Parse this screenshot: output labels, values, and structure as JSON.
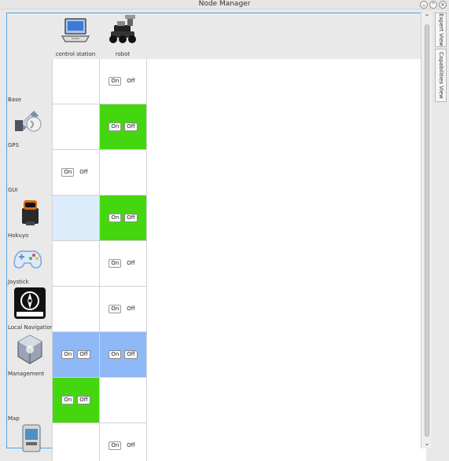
{
  "window": {
    "title": "Node Manager",
    "buttons": {
      "minimize": "⌄",
      "maximize": "⌃",
      "close": "×"
    }
  },
  "hosts": [
    {
      "label": "control station",
      "icon": "laptop-icon"
    },
    {
      "label": "robot",
      "icon": "robot-icon"
    }
  ],
  "rows": [
    {
      "label": "Base",
      "icon": null
    },
    {
      "label": "GPS",
      "icon": "gps-satellite-icon"
    },
    {
      "label": "GUI",
      "icon": null
    },
    {
      "label": "Hokuyo",
      "icon": "hokuyo-laser-icon"
    },
    {
      "label": "Joystick",
      "icon": "joystick-icon"
    },
    {
      "label": "Local Navigation",
      "icon": "navigation-icon"
    },
    {
      "label": "Management",
      "icon": "management-cube-icon"
    },
    {
      "label": "Map",
      "icon": "map-device-icon"
    }
  ],
  "toggle": {
    "on": "On",
    "off": "Off"
  },
  "cells": [
    {
      "host": 1,
      "row": 0,
      "state": "off"
    },
    {
      "host": 1,
      "row": 1,
      "state": "on"
    },
    {
      "host": 0,
      "row": 2,
      "state": "off"
    },
    {
      "host": 1,
      "row": 3,
      "state": "on"
    },
    {
      "host": 1,
      "row": 4,
      "state": "off"
    },
    {
      "host": 1,
      "row": 5,
      "state": "off"
    },
    {
      "host": 0,
      "row": 6,
      "state": "selected"
    },
    {
      "host": 1,
      "row": 6,
      "state": "selected"
    },
    {
      "host": 0,
      "row": 7,
      "state": "on"
    },
    {
      "host": 1,
      "row": 8,
      "state": "off"
    }
  ],
  "side_tabs": {
    "expert_view": "Expert View",
    "capabilities_view": "Capabilities View"
  },
  "colors": {
    "active_green": "#44d60f",
    "selected_blue": "#8fb8f7",
    "highlight_blue": "#ddecfb",
    "frame_border": "#4da3e7"
  }
}
